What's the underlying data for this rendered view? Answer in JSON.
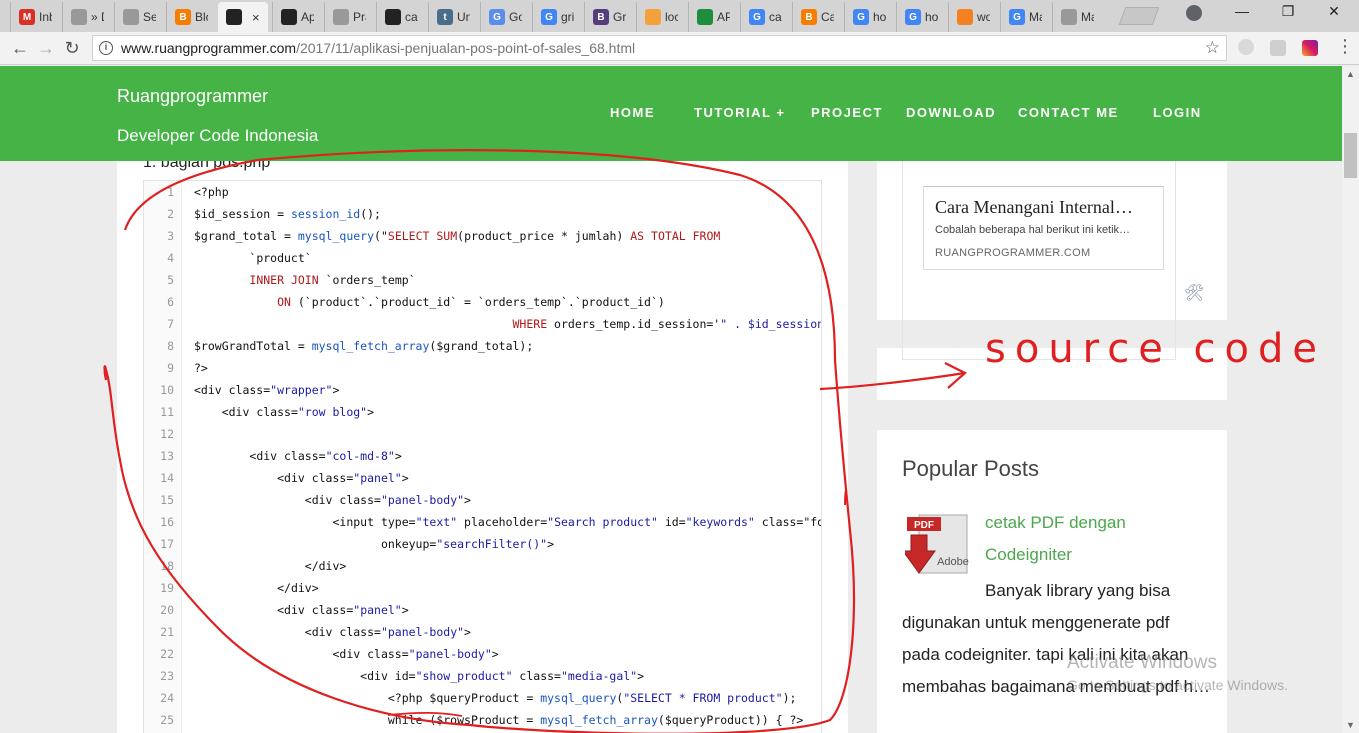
{
  "browser": {
    "tabs": [
      {
        "fav": "M",
        "color": "#d93025",
        "title": "Inb"
      },
      {
        "fav": "",
        "color": "#999999",
        "title": "» D"
      },
      {
        "fav": "",
        "color": "#999999",
        "title": "Se"
      },
      {
        "fav": "B",
        "color": "#f57d00",
        "title": "Blc"
      },
      {
        "fav": "",
        "color": "#222222",
        "title": "",
        "active": true
      },
      {
        "fav": "",
        "color": "#222222",
        "title": "Ap"
      },
      {
        "fav": "",
        "color": "#999999",
        "title": "Pra"
      },
      {
        "fav": "",
        "color": "#222222",
        "title": "cal"
      },
      {
        "fav": "t",
        "color": "#4a6d8c",
        "title": "Un"
      },
      {
        "fav": "G",
        "color": "#5a8dee",
        "title": "Go"
      },
      {
        "fav": "G",
        "color": "#4285f4",
        "title": "gri"
      },
      {
        "fav": "B",
        "color": "#563d7c",
        "title": "Gri"
      },
      {
        "fav": "",
        "color": "#f4a13b",
        "title": "loc"
      },
      {
        "fav": "",
        "color": "#1e8e3e",
        "title": "AP"
      },
      {
        "fav": "G",
        "color": "#4285f4",
        "title": "cai"
      },
      {
        "fav": "B",
        "color": "#f57d00",
        "title": "Ca"
      },
      {
        "fav": "G",
        "color": "#4285f4",
        "title": "ho"
      },
      {
        "fav": "G",
        "color": "#4285f4",
        "title": "ho"
      },
      {
        "fav": "",
        "color": "#f48024",
        "title": "wo"
      },
      {
        "fav": "G",
        "color": "#4285f4",
        "title": "Ma"
      },
      {
        "fav": "",
        "color": "#999999",
        "title": "Ma"
      }
    ],
    "close_glyph": "×",
    "url_host": "www.ruangprogrammer.com",
    "url_path": "/2017/11/aplikasi-penjualan-pos-point-of-sales_68.html",
    "window_controls": [
      "—",
      "❐",
      "✕"
    ]
  },
  "site": {
    "brand_name": "Ruangprogrammer",
    "brand_tagline": "Developer Code Indonesia",
    "menu": [
      "HOME",
      "TUTORIAL +",
      "PROJECT",
      "DOWNLOAD",
      "CONTACT ME",
      "LOGIN"
    ]
  },
  "post": {
    "section_label": "1. bagian pos.php",
    "code_lines": [
      {
        "n": "1",
        "indent": "",
        "text": "<?php"
      },
      {
        "n": "2",
        "indent": "",
        "text": "$id_session = session_id();"
      },
      {
        "n": "3",
        "indent": "",
        "text": "$grand_total = mysql_query(\"SELECT SUM(product_price * jumlah) AS TOTAL FROM"
      },
      {
        "n": "4",
        "indent": "        ",
        "text": "`product`"
      },
      {
        "n": "5",
        "indent": "        ",
        "text": "INNER JOIN `orders_temp`"
      },
      {
        "n": "6",
        "indent": "            ",
        "text": "ON (`product`.`product_id` = `orders_temp`.`product_id`)"
      },
      {
        "n": "7",
        "indent": "                                              ",
        "text": "WHERE orders_temp.id_session='\" . $id_session . \"'\""
      },
      {
        "n": "8",
        "indent": "",
        "text": "$rowGrandTotal = mysql_fetch_array($grand_total);"
      },
      {
        "n": "9",
        "indent": "",
        "text": "?>"
      },
      {
        "n": "10",
        "indent": "",
        "text": "<div class=\"wrapper\">"
      },
      {
        "n": "11",
        "indent": "    ",
        "text": "<div class=\"row blog\">"
      },
      {
        "n": "12",
        "indent": "",
        "text": ""
      },
      {
        "n": "13",
        "indent": "        ",
        "text": "<div class=\"col-md-8\">"
      },
      {
        "n": "14",
        "indent": "            ",
        "text": "<div class=\"panel\">"
      },
      {
        "n": "15",
        "indent": "                ",
        "text": "<div class=\"panel-body\">"
      },
      {
        "n": "16",
        "indent": "                    ",
        "text": "<input type=\"text\" placeholder=\"Search product\" id=\"keywords\" class=\"form-co"
      },
      {
        "n": "17",
        "indent": "                           ",
        "text": "onkeyup=\"searchFilter()\">"
      },
      {
        "n": "18",
        "indent": "                ",
        "text": "</div>"
      },
      {
        "n": "19",
        "indent": "            ",
        "text": "</div>"
      },
      {
        "n": "20",
        "indent": "            ",
        "text": "<div class=\"panel\">"
      },
      {
        "n": "21",
        "indent": "                ",
        "text": "<div class=\"panel-body\">"
      },
      {
        "n": "22",
        "indent": "                    ",
        "text": "<div class=\"panel-body\">"
      },
      {
        "n": "23",
        "indent": "                        ",
        "text": "<div id=\"show_product\" class=\"media-gal\">"
      },
      {
        "n": "24",
        "indent": "                            ",
        "text": "<?php $queryProduct = mysql_query(\"SELECT * FROM product\");"
      },
      {
        "n": "25",
        "indent": "                            ",
        "text": "while ($rowsProduct = mysql_fetch_array($queryProduct)) { ?>"
      }
    ]
  },
  "sidebar": {
    "ad": {
      "title": "Cara Menangani Internal…",
      "desc": "Cobalah beberapa hal berikut ini ketik…",
      "site": "RUANGPROGRAMMER.COM"
    },
    "popular": {
      "heading": "Popular Posts",
      "items": [
        {
          "link_lines": [
            "cetak PDF dengan",
            "Codeigniter"
          ],
          "excerpt_lines": [
            "Banyak library yang bisa",
            "digunakan untuk menggenerate pdf",
            "pada codeigniter. tapi kali ini kita akan",
            "membahas bagaimana membuat pdf h…"
          ],
          "icon_label": "PDF",
          "icon_brand": "Adobe"
        }
      ]
    }
  },
  "annotation": {
    "text": "source code",
    "color": "#e02020"
  },
  "os_watermark": {
    "line1": "Activate Windows",
    "line2": "Go to Settings to activate Windows."
  }
}
